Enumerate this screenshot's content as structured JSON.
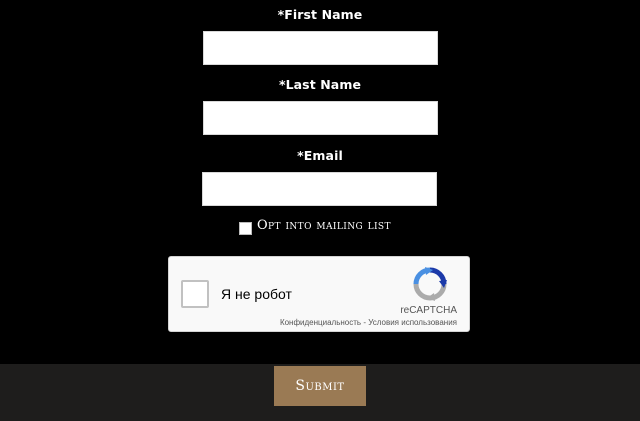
{
  "form": {
    "first_name": {
      "label": "*First Name",
      "value": ""
    },
    "last_name": {
      "label": "*Last Name",
      "value": ""
    },
    "email": {
      "label": "*Email",
      "value": ""
    },
    "optin_label": "Opt into mailing list",
    "submit_label": "Submit"
  },
  "recaptcha": {
    "label": "Я не робот",
    "brand": "reCAPTCHA",
    "privacy_link": "Конфиденциальность",
    "separator": " - ",
    "terms_link": "Условия использования",
    "logo_icon": "recaptcha-logo-icon"
  },
  "colors": {
    "background": "#000000",
    "footer": "#1e1d1c",
    "submit_button": "#9a7a54",
    "recaptcha_blue": "#4a90e2",
    "recaptcha_dark_blue": "#1c3aa9",
    "recaptcha_gray": "#ababab"
  }
}
